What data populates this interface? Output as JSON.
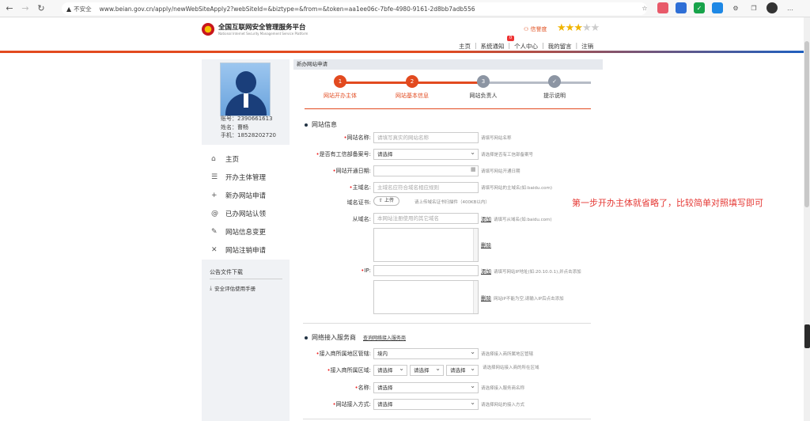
{
  "browser": {
    "security_label": "不安全",
    "url": "www.beian.gov.cn/apply/newWebSiteApply2?webSiteId=&biztype=&from=&token=aa1ee06c-7bfe-4980-9161-2d8bb7adb556"
  },
  "header": {
    "site_title": "全国互联网安全管理服务平台",
    "site_subtitle": "National Internet Security Management Service Platform",
    "credit_label": "信誉度",
    "credit_stars": 3,
    "credit_max": 5,
    "nav": [
      "主页",
      "系统通知",
      "个人中心",
      "我的留言",
      "注销"
    ],
    "notification_count": "0"
  },
  "user": {
    "account": "账号：2390661613",
    "name": "姓名：曹畅",
    "phone": "手机：18528202720"
  },
  "menu": [
    {
      "label": "主页",
      "icon": "home-icon",
      "glyph": "⌂"
    },
    {
      "label": "开办主体管理",
      "icon": "list-icon",
      "glyph": "☰"
    },
    {
      "label": "新办网站申请",
      "icon": "plus-icon",
      "glyph": "+"
    },
    {
      "label": "已办网站认领",
      "icon": "at-icon",
      "glyph": "@"
    },
    {
      "label": "网站信息变更",
      "icon": "edit-icon",
      "glyph": "✎"
    },
    {
      "label": "网站注销申请",
      "icon": "close-icon",
      "glyph": "✕"
    }
  ],
  "downloads": {
    "title": "公告文件下载",
    "item": "安全评估使用手册"
  },
  "main": {
    "header": "新办网站申请",
    "steps": [
      {
        "num": "1",
        "label": "网站开办主体",
        "state": "done"
      },
      {
        "num": "2",
        "label": "网站基本信息",
        "state": "active"
      },
      {
        "num": "3",
        "label": "网站负责人",
        "state": "todo"
      },
      {
        "num": "✓",
        "label": "提示说明",
        "state": "todo"
      }
    ],
    "site_info_title": "网站信息",
    "fields": {
      "site_name": {
        "label": "网站名称:",
        "placeholder": "请填写真实的网站名称",
        "hint": "请填写网站名称"
      },
      "miit_filed": {
        "label": "是否有工信部备案号:",
        "value": "请选择",
        "hint": "请选择是否有工信部备案号"
      },
      "open_date": {
        "label": "网站开通日期:",
        "hint": "请填写网站开通日期"
      },
      "main_domain": {
        "label": "主域名:",
        "placeholder": "主域名应符合域名相应规则",
        "hint": "请填写网站的主域名(如:baidu.com)"
      },
      "domain_cert": {
        "label": "域名证书:",
        "button": "上传",
        "hint": "请上传域名证书扫描件（400KB以内）"
      },
      "sub_domain": {
        "label": "从域名:",
        "placeholder": "本网站注册使用的其它域名",
        "add": "添加",
        "hint": "请填写从域名(如:baidu.com)",
        "delete": "删除"
      },
      "ip": {
        "label": "IP:",
        "add": "添加",
        "hint": "请填写网站IP地址(如:20.10.0.1),并点击添加",
        "delete": "删除",
        "delete_hint": "网站IP不能为空,请输入IP后点击添加"
      }
    },
    "isp_title": "网络接入服务商",
    "isp_link": "查询网络接入服务商",
    "isp_fields": {
      "region_mgmt": {
        "label": "接入商所属地区管辖:",
        "value": "境内",
        "hint": "请选择接入商所属地区管辖"
      },
      "region": {
        "label": "接入商所属区域:",
        "values": [
          "请选择",
          "请选择",
          "请选择"
        ],
        "hint": "请选择网站接入商的所在区域"
      },
      "name": {
        "label": "名称:",
        "value": "请选择",
        "hint": "请选择接入服务商名称"
      },
      "method": {
        "label": "网站接入方式:",
        "value": "请选择",
        "hint": "请选择网站的接入方式"
      }
    }
  },
  "annotation": "第一步开办主体就省略了，比较简单对照填写即可",
  "colors": {
    "accent": "#e24a1f",
    "step_todo": "#8c95a3",
    "note": "#e53935"
  }
}
